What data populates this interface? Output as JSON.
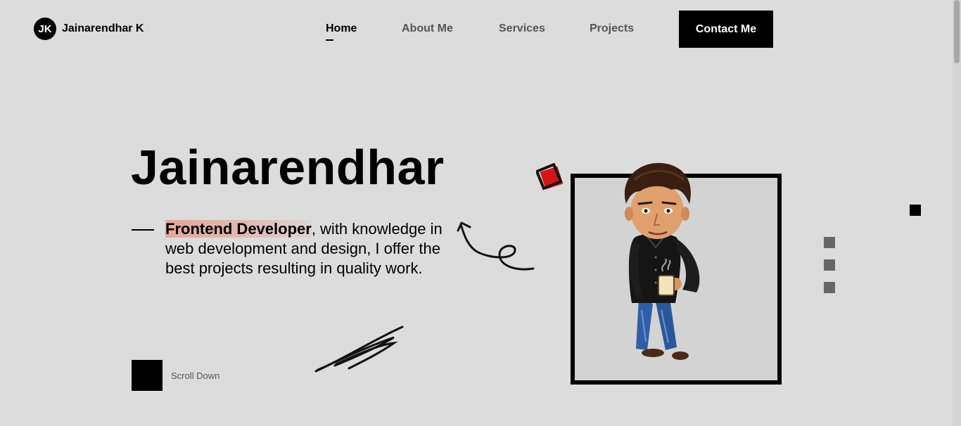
{
  "header": {
    "logo_initials": "JK",
    "logo_name": "Jainarendhar K",
    "nav": [
      {
        "label": "Home",
        "active": true
      },
      {
        "label": "About Me",
        "active": false
      },
      {
        "label": "Services",
        "active": false
      },
      {
        "label": "Projects",
        "active": false
      }
    ],
    "contact_label": "Contact Me"
  },
  "hero": {
    "title": "Jainarendhar",
    "highlight": "Frontend Developer",
    "description": ", with knowledge in web development and design, I offer the best projects resulting in quality work.",
    "scroll_label": "Scroll Down"
  },
  "colors": {
    "background": "#dcdcdc",
    "accent": "#000000",
    "highlight": "#e69682",
    "nav_inactive": "#555555"
  },
  "icons": [
    "curl-arrow-icon",
    "scribble-icon",
    "red-square-icon",
    "avatar-illustration"
  ]
}
